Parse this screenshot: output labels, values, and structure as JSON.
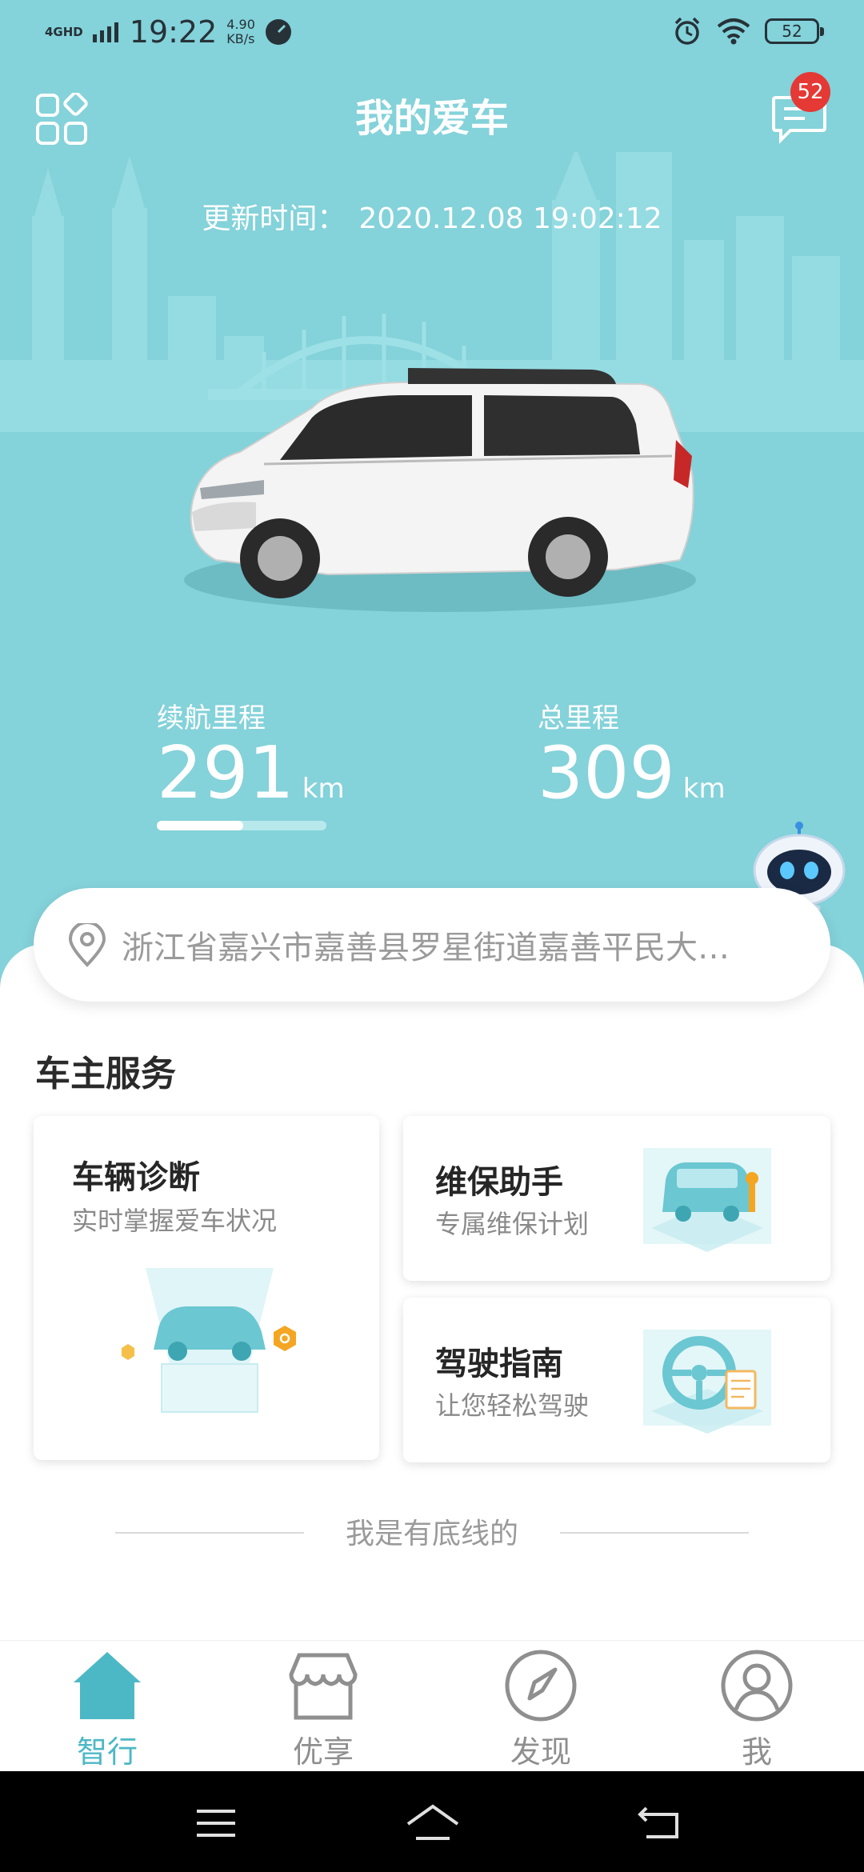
{
  "status_bar": {
    "network": "4GHD",
    "time": "19:22",
    "speed_value": "4.90",
    "speed_unit": "KB/s",
    "battery": "52"
  },
  "header": {
    "title": "我的爱车",
    "message_badge": "52",
    "grid_icon": "grid-icon",
    "message_icon": "message-icon"
  },
  "vehicle": {
    "update_label": "更新时间：",
    "update_time": "2020.12.08 19:02:12",
    "range_label": "续航里程",
    "range_value": "291",
    "range_unit": "km",
    "range_fraction": 0.51,
    "total_label": "总里程",
    "total_value": "309",
    "total_unit": "km"
  },
  "location": {
    "address": "浙江省嘉兴市嘉善县罗星街道嘉善平民大…"
  },
  "services": {
    "section_title": "车主服务",
    "diagnosis": {
      "title": "车辆诊断",
      "subtitle": "实时掌握爱车状况"
    },
    "maintenance": {
      "title": "维保助手",
      "subtitle": "专属维保计划"
    },
    "driving_guide": {
      "title": "驾驶指南",
      "subtitle": "让您轻松驾驶"
    }
  },
  "footer_note": "我是有底线的",
  "tabs": [
    {
      "label": "智行",
      "icon": "home-icon",
      "active": true
    },
    {
      "label": "优享",
      "icon": "shop-icon",
      "active": false
    },
    {
      "label": "发现",
      "icon": "compass-icon",
      "active": false
    },
    {
      "label": "我",
      "icon": "person-icon",
      "active": false
    }
  ],
  "colors": {
    "hero_bg": "#84d2da",
    "accent": "#4db8c5",
    "inactive_tab": "#8f8f8f",
    "badge": "#e53935"
  }
}
